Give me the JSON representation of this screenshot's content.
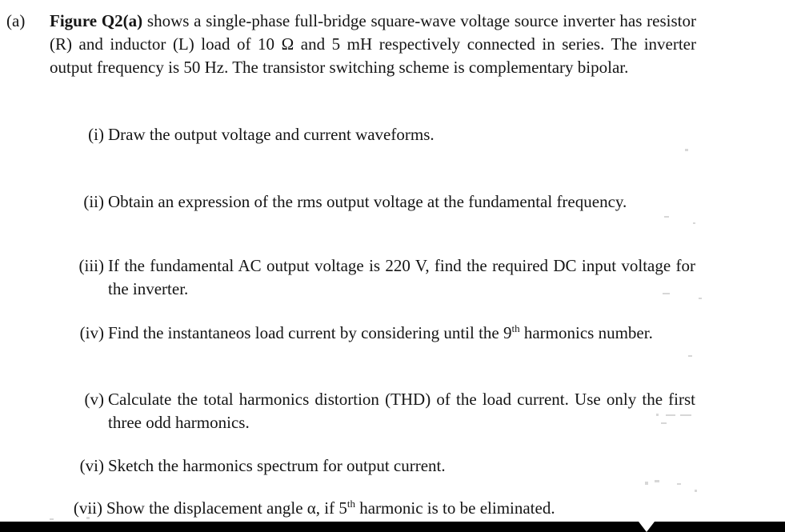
{
  "document": {
    "part_label": "(a)",
    "intro": {
      "bold_lead": "Figure Q2(a)",
      "rest": " shows a single-phase full-bridge square-wave voltage source inverter has resistor (R) and inductor (L) load of 10 Ω and 5 mH respectively connected in series. The inverter output frequency is 50 Hz. The transistor switching scheme is complementary bipolar."
    },
    "sub_questions": [
      {
        "numeral": "(i)",
        "text": "Draw the output voltage and current waveforms."
      },
      {
        "numeral": "(ii)",
        "text": "Obtain an expression of the rms output voltage at the fundamental frequency."
      },
      {
        "numeral": "(iii)",
        "text": "If the fundamental AC output voltage is 220 V, find the required DC input voltage for the inverter."
      },
      {
        "numeral": "(iv)",
        "text_before": "Find the instantaneos load current by considering until the 9",
        "superscript": "th",
        "text_after": " harmonics number."
      },
      {
        "numeral": "(v)",
        "text": "Calculate the total harmonics distortion (THD) of the load current. Use only the first three odd harmonics."
      },
      {
        "numeral": "(vi)",
        "text": "Sketch the harmonics spectrum for output current."
      },
      {
        "numeral": "(vii)",
        "text_before": "Show the displacement angle α, if 5",
        "superscript": "th",
        "text_after": " harmonic is to be eliminated."
      }
    ]
  },
  "style": {
    "background_color": "#ffffff",
    "text_color": "#151515",
    "band_color": "#000000",
    "notch_color": "#ffffff"
  }
}
